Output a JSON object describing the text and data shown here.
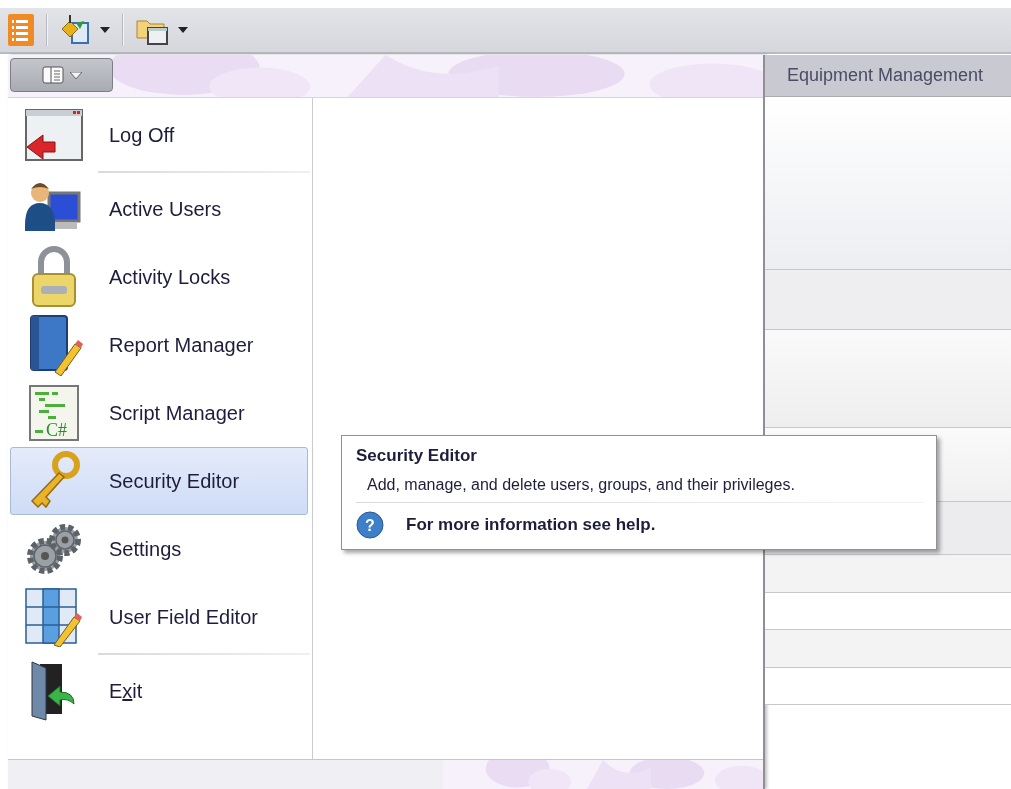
{
  "toolbar": {
    "buttons": [
      {
        "kind": "list",
        "dropdown": false
      },
      {
        "kind": "paint",
        "dropdown": true
      },
      {
        "kind": "folder",
        "dropdown": true
      }
    ]
  },
  "menu": {
    "items": [
      {
        "kind": "item",
        "label": "Log Off",
        "selected": false
      },
      {
        "kind": "separator"
      },
      {
        "kind": "item",
        "label": "Active Users",
        "selected": false
      },
      {
        "kind": "item",
        "label": "Activity Locks",
        "selected": false
      },
      {
        "kind": "item",
        "label": "Report Manager",
        "selected": false
      },
      {
        "kind": "item",
        "label": "Script Manager",
        "icon_text": "C#",
        "selected": false
      },
      {
        "kind": "item",
        "label": "Security Editor",
        "selected": true
      },
      {
        "kind": "item",
        "label": "Settings",
        "selected": false
      },
      {
        "kind": "item",
        "label": "User Field Editor",
        "selected": false
      },
      {
        "kind": "separator"
      },
      {
        "kind": "item",
        "label_before": "E",
        "access_key": "x",
        "label_after": "it",
        "selected": false
      }
    ]
  },
  "tab": {
    "label": "Equipment Management"
  },
  "tooltip": {
    "title": "Security Editor",
    "description": "Add, manage, and delete users, groups, and their privileges.",
    "help_icon": "?",
    "help": "For more information see help."
  }
}
